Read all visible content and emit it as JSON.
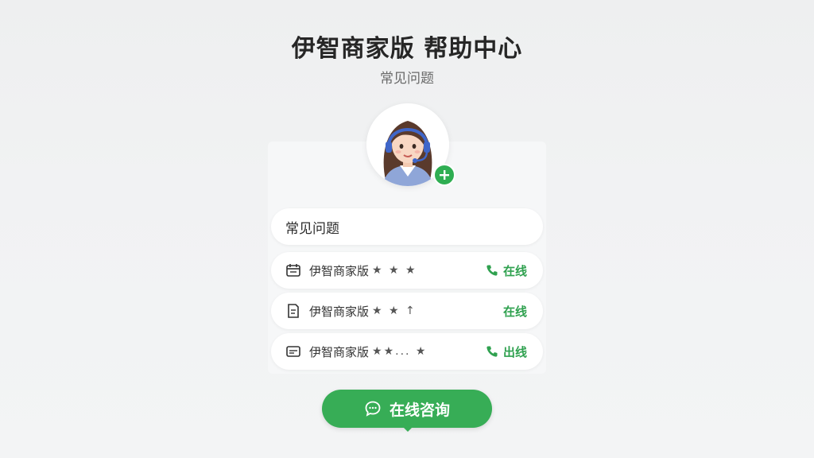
{
  "header": {
    "title": "伊智商家版 帮助中心",
    "subtitle": "常见问题"
  },
  "avatar": {
    "icon": "customer-service-agent-avatar",
    "badge_icon": "plus-icon"
  },
  "list": {
    "header_label": "常见问题",
    "items": [
      {
        "icon": "calendar-icon",
        "name": "伊智商家版",
        "stars": "★ ★ ★",
        "status": "在线",
        "status_icon": "phone-icon"
      },
      {
        "icon": "document-icon",
        "name": "伊智商家版",
        "stars": "★ ★ ↑",
        "status": "在线",
        "status_icon": ""
      },
      {
        "icon": "card-icon",
        "name": "伊智商家版",
        "stars": "★★... ★",
        "status": "出线",
        "status_icon": "phone-icon"
      }
    ]
  },
  "cta": {
    "label": "在线咨询",
    "icon": "chat-bubble-icon"
  },
  "colors": {
    "accent": "#37ad56",
    "status": "#2fa14f"
  }
}
